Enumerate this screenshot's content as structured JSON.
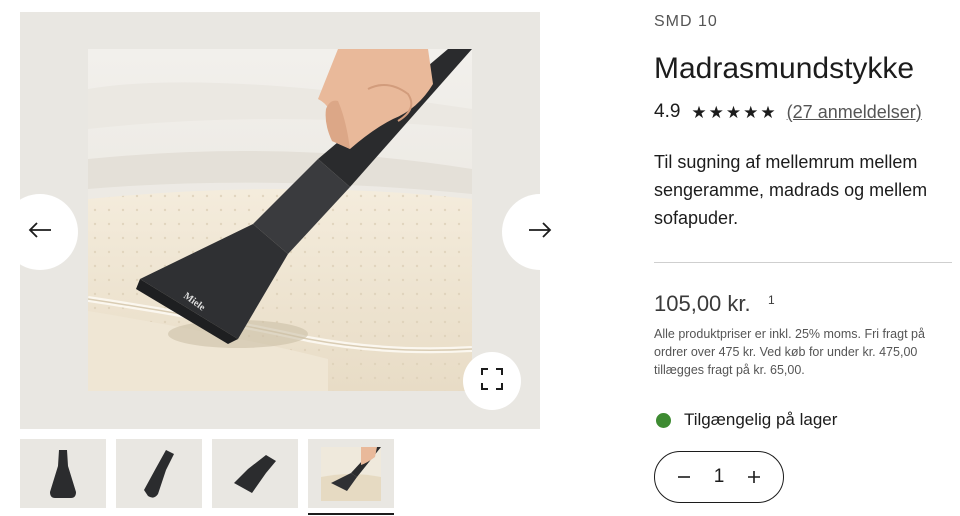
{
  "product": {
    "sku": "SMD 10",
    "title": "Madrasmundstykke",
    "rating": "4.9",
    "stars": 5,
    "reviews_link": "(27 anmeldelser)",
    "description": "Til sugning af mellemrum mellem sengeramme, madrads og mellem sofapuder.",
    "price": "105,00 kr.",
    "price_footnote": "1",
    "price_info": "Alle produktpriser er inkl. 25% moms. Fri fragt på ordrer over 475 kr. Ved køb for under kr. 475,00 tillægges fragt på kr. 65,00.",
    "stock_text": "Tilgængelig på lager",
    "stock_color": "#3e8b32"
  },
  "quantity": {
    "value": "1",
    "decrement_icon": "minus-icon",
    "increment_icon": "plus-icon"
  },
  "gallery": {
    "background_color": "#e9e7e2",
    "prev_icon": "arrow-left-icon",
    "next_icon": "arrow-right-icon",
    "zoom_icon": "fullscreen-icon",
    "thumbnails": [
      {
        "name": "thumb-1",
        "active": false
      },
      {
        "name": "thumb-2",
        "active": false
      },
      {
        "name": "thumb-3",
        "active": false
      },
      {
        "name": "thumb-4",
        "active": true
      }
    ]
  }
}
